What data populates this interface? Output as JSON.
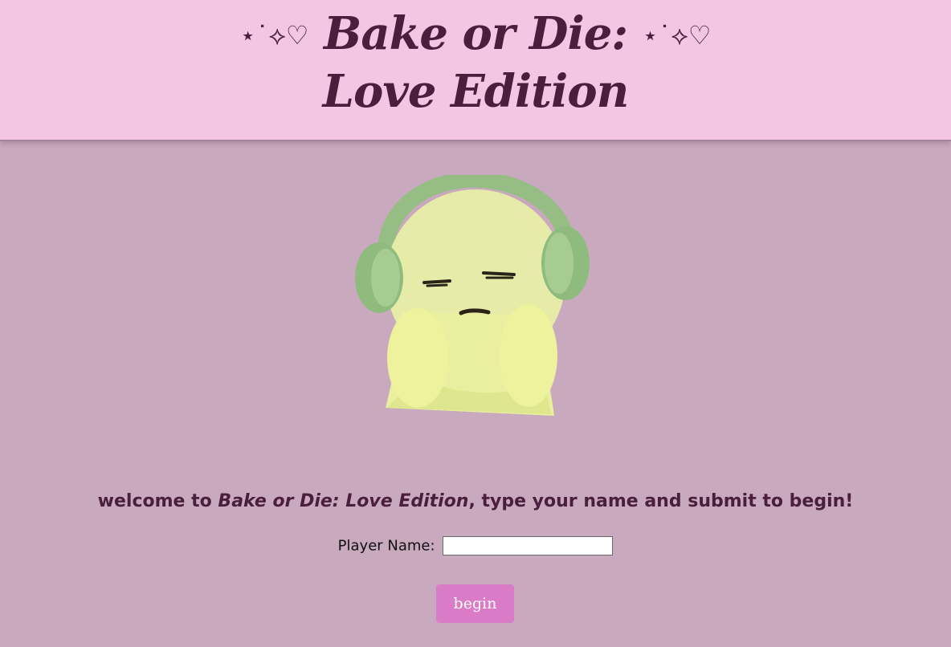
{
  "header": {
    "title_line1": "Bake or Die:",
    "title_line2": "Love Edition",
    "decoration_left": "⋆˙⟡♡",
    "decoration_right": "⋆˙⟡♡"
  },
  "mascot": {
    "icon": "headphones-character-image"
  },
  "welcome": {
    "prefix": "welcome to ",
    "game_name": "Bake or Die: Love Edition",
    "suffix": ", type your name and submit to begin!"
  },
  "form": {
    "player_name_label": "Player Name:",
    "player_name_value": "",
    "submit_label": "begin"
  },
  "colors": {
    "page_background": "#c9a9be",
    "header_background": "#f3c6e4",
    "title_text": "#4a1f3d",
    "button_background": "#d97bc6",
    "button_text": "#ffffff"
  }
}
